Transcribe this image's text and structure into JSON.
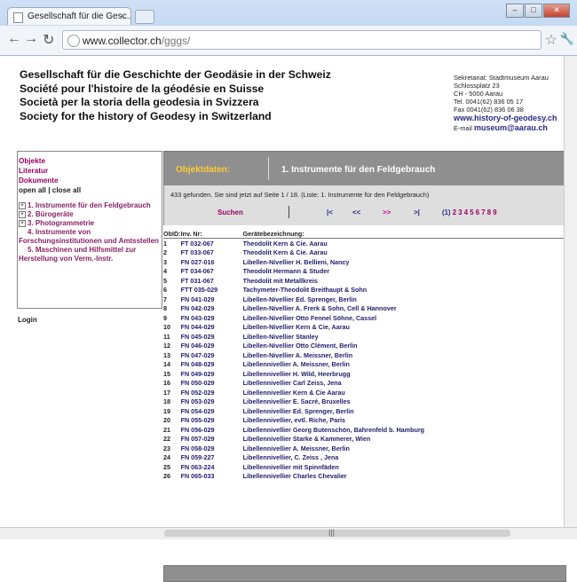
{
  "browser": {
    "tab_title": "Gesellschaft für die Gesc...",
    "url_host": "www.collector.ch",
    "url_path": "/gggs/"
  },
  "header": {
    "lines": [
      "Gesellschaft für die Geschichte der Geodäsie in der Schweiz",
      "Société pour l'histoire de la géodésie en Suisse",
      "Società per la storia della geodesia in Svizzera",
      "Society for the history of Geodesy in Switzerland"
    ]
  },
  "contact": {
    "secretariat": "Sekretariat: Stadtmuseum Aarau",
    "street": "Schlossplatz 23",
    "city": "CH - 5000 Aarau",
    "tel": "Tel. 0041(62) 836 05 17",
    "fax": "Fax 0041(62) 836 06 38",
    "website": "www.history-of-geodesy.ch",
    "email_prefix": "E-mail",
    "email": "museum@aarau.ch"
  },
  "sidebar": {
    "links": [
      "Objekte",
      "Literatur",
      "Dokumente"
    ],
    "open_close": "open all | close all",
    "tree": [
      "1. Instrumente für den Feldgebrauch",
      "2. Bürogeräte",
      "3. Photogrammetrie",
      "4. Instrumente von Forschungsinstitutionen und Amtsstellen",
      "5. Maschinen und Hilfsmittel zur Herstellung von Verm.-Instr."
    ],
    "login": "Login"
  },
  "content": {
    "tab_label": "Objektdaten:",
    "category_title": "1. Instrumente für den Feldgebrauch",
    "count_text": "433 gefunden. Sie sind jetzt auf Seite 1 / 18.  (Liste: 1. Instrumente für den Feldgebrauch)",
    "search_label": "Suchen",
    "pager": {
      "first": "|<",
      "prev": "<<",
      "next": ">>",
      "last": ">|"
    },
    "pages_prefix": "(1)",
    "pages": "2 3 4 5 6 7 8 9",
    "columns": [
      "ObID:",
      "Inv. Nr:",
      "Gerätebezeichnung:"
    ],
    "rows": [
      [
        "1",
        "FT 032-067",
        "Theodolit Kern & Cie. Aarau"
      ],
      [
        "2",
        "FT 033-067",
        "Theodolit Kern & Cie. Aarau"
      ],
      [
        "3",
        "FN 027-016",
        "Libellen-Nivellier H. Bellieni, Nancy"
      ],
      [
        "4",
        "FT 034-067",
        "Theodolit Hermann & Studer"
      ],
      [
        "5",
        "FT 031-067",
        "Theodolit mit Metallkreis"
      ],
      [
        "6",
        "FTT 035-029",
        "Tachymeter-Theodolit Breithaupt & Sohn"
      ],
      [
        "7",
        "FN 041-029",
        "Libellen-Nivellier Ed. Sprenger, Berlin"
      ],
      [
        "8",
        "FN 042-029",
        "Libellen-Nivellier A. Frerk & Sohn, Cell & Hannover"
      ],
      [
        "9",
        "FN 043-029",
        "Libellen-Nivellier Otto Fennel Söhne, Cassel"
      ],
      [
        "10",
        "FN 044-029",
        "Libellen-Nivellier Kern & Cie, Aarau"
      ],
      [
        "11",
        "FN 045-029",
        "Libellen-Nivellier Stanley"
      ],
      [
        "12",
        "FN 046-029",
        "Libellen-Nivellier Otto Clément, Berlin"
      ],
      [
        "13",
        "FN 047-029",
        "Libellen-Nivellier A. Meissner, Berlin"
      ],
      [
        "14",
        "FN 048-029",
        "Libellennivellier A. Meissner, Berlin"
      ],
      [
        "15",
        "FN 049-029",
        "Libellennivellier H. Wild, Heerbrugg"
      ],
      [
        "16",
        "FN 050-029",
        "Libellennivellier Carl Zeiss, Jena"
      ],
      [
        "17",
        "FN 052-029",
        "Libellennivellier Kern & Cie Aarau"
      ],
      [
        "18",
        "FN 053-029",
        "Libellennivellier E. Sacré, Bruxelles"
      ],
      [
        "19",
        "FN 054-029",
        "Libellennivellier Ed. Sprenger, Berlin"
      ],
      [
        "20",
        "FN 055-029",
        "Libellennivellier, evtl. Riche, Paris"
      ],
      [
        "21",
        "FN 056-029",
        "Libellennivellier Georg Butenschön, Bahrenfeld b. Hamburg"
      ],
      [
        "22",
        "FN 057-029",
        "Libellennivellier Starke & Kammerer, Wien"
      ],
      [
        "23",
        "FN 058-029",
        "Libellennivellier A. Meissner, Berlin"
      ],
      [
        "24",
        "FN 059-227",
        "Libellennivellier, C. Zeiss , Jena"
      ],
      [
        "25",
        "FN 063-224",
        "Libellennivellier mit Spinnfäden"
      ],
      [
        "26",
        "FN 065-033",
        "Libellennivellier Charles Chevalier"
      ]
    ]
  }
}
